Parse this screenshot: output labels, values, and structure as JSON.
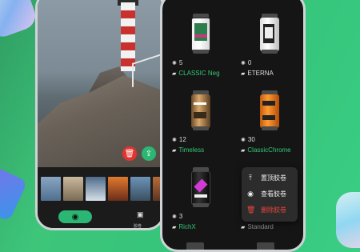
{
  "left_phone": {
    "bottom_nav": [
      {
        "icon": "camera-icon",
        "label": ""
      },
      {
        "icon": "album-icon",
        "label": "胶卷"
      }
    ],
    "photo_actions": [
      {
        "icon": "trash-icon",
        "color": "#e3342f"
      },
      {
        "icon": "share-icon",
        "color": "#2bb673"
      }
    ]
  },
  "film_rolls": [
    {
      "name": "CLASSIC Neg",
      "count": "5",
      "highlight": true
    },
    {
      "name": "ETERNA",
      "count": "0",
      "highlight": false
    },
    {
      "name": "Timeless",
      "count": "12",
      "highlight": true
    },
    {
      "name": "ClassicChrome",
      "count": "30",
      "highlight": true
    },
    {
      "name": "RichX",
      "count": "3",
      "highlight": true
    },
    {
      "name": "Standard",
      "count": "",
      "highlight": false
    }
  ],
  "context_menu": {
    "items": [
      {
        "label": "置顶胶卷",
        "icon": "pin-top-icon",
        "danger": false
      },
      {
        "label": "查看胶卷",
        "icon": "eye-icon",
        "danger": false
      },
      {
        "label": "删除胶卷",
        "icon": "trash-icon",
        "danger": true
      }
    ]
  },
  "colors": {
    "accent": "#33c774",
    "danger": "#e8453c"
  }
}
